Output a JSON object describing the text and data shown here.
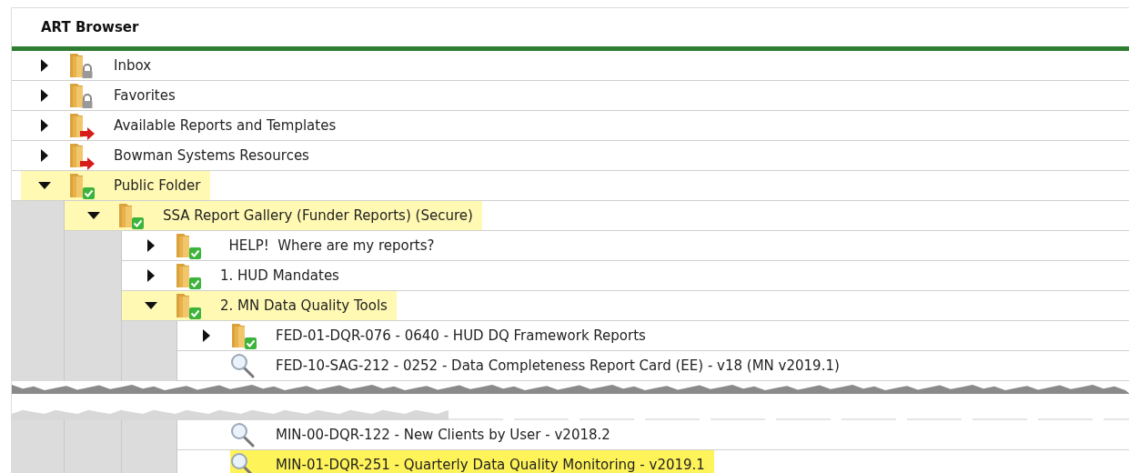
{
  "panel": {
    "title": "ART Browser"
  },
  "tree": [
    {
      "kind": "locked",
      "label": "Inbox",
      "expanded": false,
      "selected": false
    },
    {
      "kind": "locked",
      "label": "Favorites",
      "expanded": false,
      "selected": false
    },
    {
      "kind": "shortcut",
      "label": "Available Reports and Templates",
      "expanded": false,
      "selected": false
    },
    {
      "kind": "shortcut",
      "label": "Bowman Systems Resources",
      "expanded": false,
      "selected": false
    },
    {
      "kind": "shared",
      "label": "Public Folder",
      "expanded": true,
      "selected": false,
      "children": [
        {
          "kind": "shared",
          "label": "SSA Report Gallery (Funder Reports) (Secure)",
          "expanded": true,
          "selected": false,
          "children": [
            {
              "kind": "shared",
              "label": "  HELP!  Where are my reports?",
              "expanded": false,
              "selected": false
            },
            {
              "kind": "shared",
              "label": "1. HUD Mandates",
              "expanded": false,
              "selected": false
            },
            {
              "kind": "shared",
              "label": "2. MN Data Quality Tools",
              "expanded": true,
              "selected": false,
              "children": [
                {
                  "kind": "shared",
                  "label": "FED-01-DQR-076 - 0640 - HUD DQ Framework Reports",
                  "expanded": false,
                  "selected": false
                },
                {
                  "kind": "report",
                  "label": "FED-10-SAG-212 - 0252 - Data Completeness Report Card (EE) - v18 (MN v2019.1)",
                  "selected": false
                },
                {
                  "kind": "tear"
                },
                {
                  "kind": "report",
                  "label": "MIN-00-DQR-122 - New Clients by User - v2018.2",
                  "selected": false
                },
                {
                  "kind": "report",
                  "label": "MIN-01-DQR-251 - Quarterly Data Quality Monitoring - v2019.1",
                  "selected": true
                }
              ]
            }
          ]
        }
      ]
    }
  ]
}
